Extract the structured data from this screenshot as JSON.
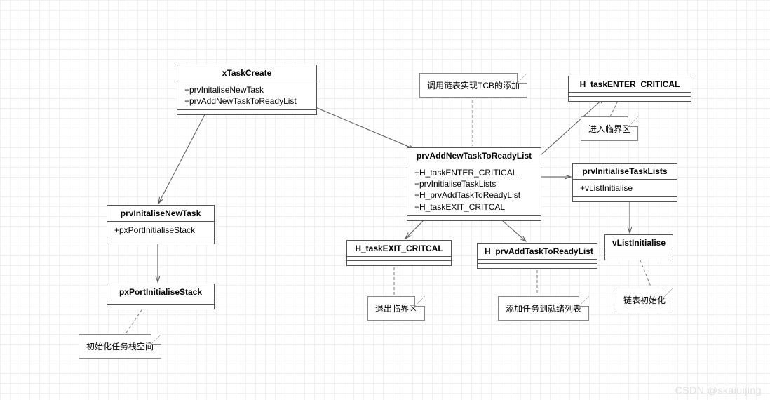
{
  "classes": {
    "xTaskCreate": {
      "title": "xTaskCreate",
      "methods": [
        "+prvInitaliseNewTask",
        "+prvAddNewTaskToReadyList"
      ]
    },
    "prvInitaliseNewTask": {
      "title": "prvInitaliseNewTask",
      "methods": [
        "+pxPortInitialiseStack"
      ]
    },
    "pxPortInitialiseStack": {
      "title": "pxPortInitialiseStack",
      "methods": []
    },
    "prvAddNewTaskToReadyList": {
      "title": "prvAddNewTaskToReadyList",
      "methods": [
        "+H_taskENTER_CRITICAL",
        "+prvInitialiseTaskLists",
        "+H_prvAddTaskToReadyList",
        "+H_taskEXIT_CRITCAL"
      ]
    },
    "H_taskENTER_CRITICAL": {
      "title": "H_taskENTER_CRITICAL",
      "methods": []
    },
    "prvInitialiseTaskLists": {
      "title": "prvInitialiseTaskLists",
      "methods": [
        "+vListInitialise"
      ]
    },
    "H_taskEXIT_CRITCAL": {
      "title": "H_taskEXIT_CRITCAL",
      "methods": []
    },
    "H_prvAddTaskToReadyList": {
      "title": "H_prvAddTaskToReadyList",
      "methods": []
    },
    "vListInitialise": {
      "title": "vListInitialise",
      "methods": []
    }
  },
  "notes": {
    "tcb": "调用链表实现TCB的添加",
    "enterCritical": "进入临界区",
    "exitCritical": "退出临界区",
    "addReady": "添加任务到就绪列表",
    "listInit": "链表初始化",
    "stackInit": "初始化任务栈空间"
  },
  "watermark": "CSDN @skaiuijing"
}
